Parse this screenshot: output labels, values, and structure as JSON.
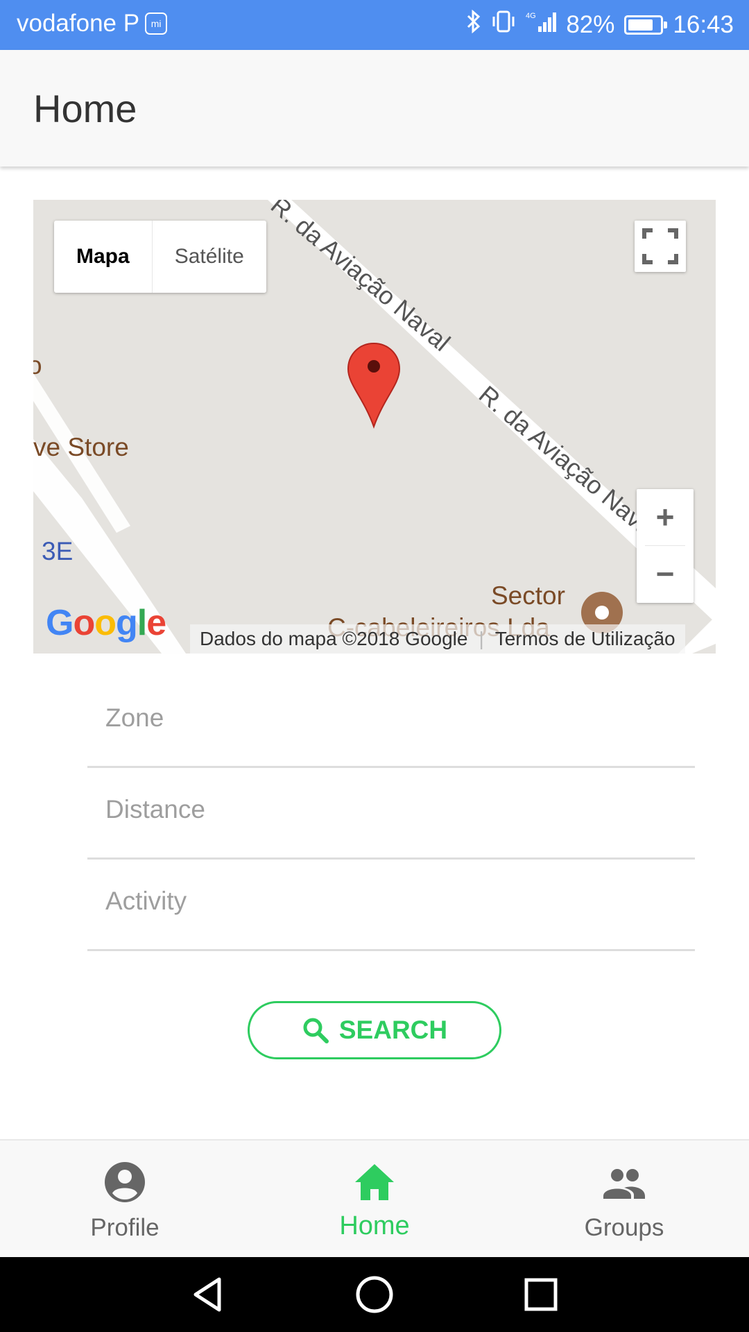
{
  "status_bar": {
    "carrier": "vodafone P",
    "carrier_icon": "mi",
    "network": "4G",
    "battery": "82%",
    "battery_level": 0.82,
    "time": "16:43"
  },
  "app_bar": {
    "title": "Home"
  },
  "map": {
    "map_type_options": [
      "Mapa",
      "Satélite"
    ],
    "selected_map_type": "Mapa",
    "zoom_in_label": "+",
    "zoom_out_label": "−",
    "street_labels": [
      "R. da Aviação Naval",
      "R. da Aviação Naval"
    ],
    "poi_labels": [
      "ve Store",
      "3E",
      "Sector",
      "C-cabeleireiros Lda",
      "o"
    ],
    "google_logo": "Google",
    "attribution": "Dados do mapa ©2018 Google",
    "terms": "Termos de Utilização"
  },
  "form": {
    "zone_placeholder": "Zone",
    "distance_placeholder": "Distance",
    "activity_placeholder": "Activity",
    "zone_value": "",
    "distance_value": "",
    "activity_value": ""
  },
  "search_button": {
    "label": "SEARCH",
    "icon": "search-icon"
  },
  "bottom_nav": {
    "items": [
      {
        "label": "Profile",
        "icon": "account-circle-icon"
      },
      {
        "label": "Home",
        "icon": "home-icon",
        "active": true
      },
      {
        "label": "Groups",
        "icon": "groups-icon"
      }
    ]
  },
  "colors": {
    "status_bar": "#4f8ef0",
    "accent": "#2ecc5f",
    "map_background": "#e5e3df",
    "marker": "#ea4335"
  }
}
